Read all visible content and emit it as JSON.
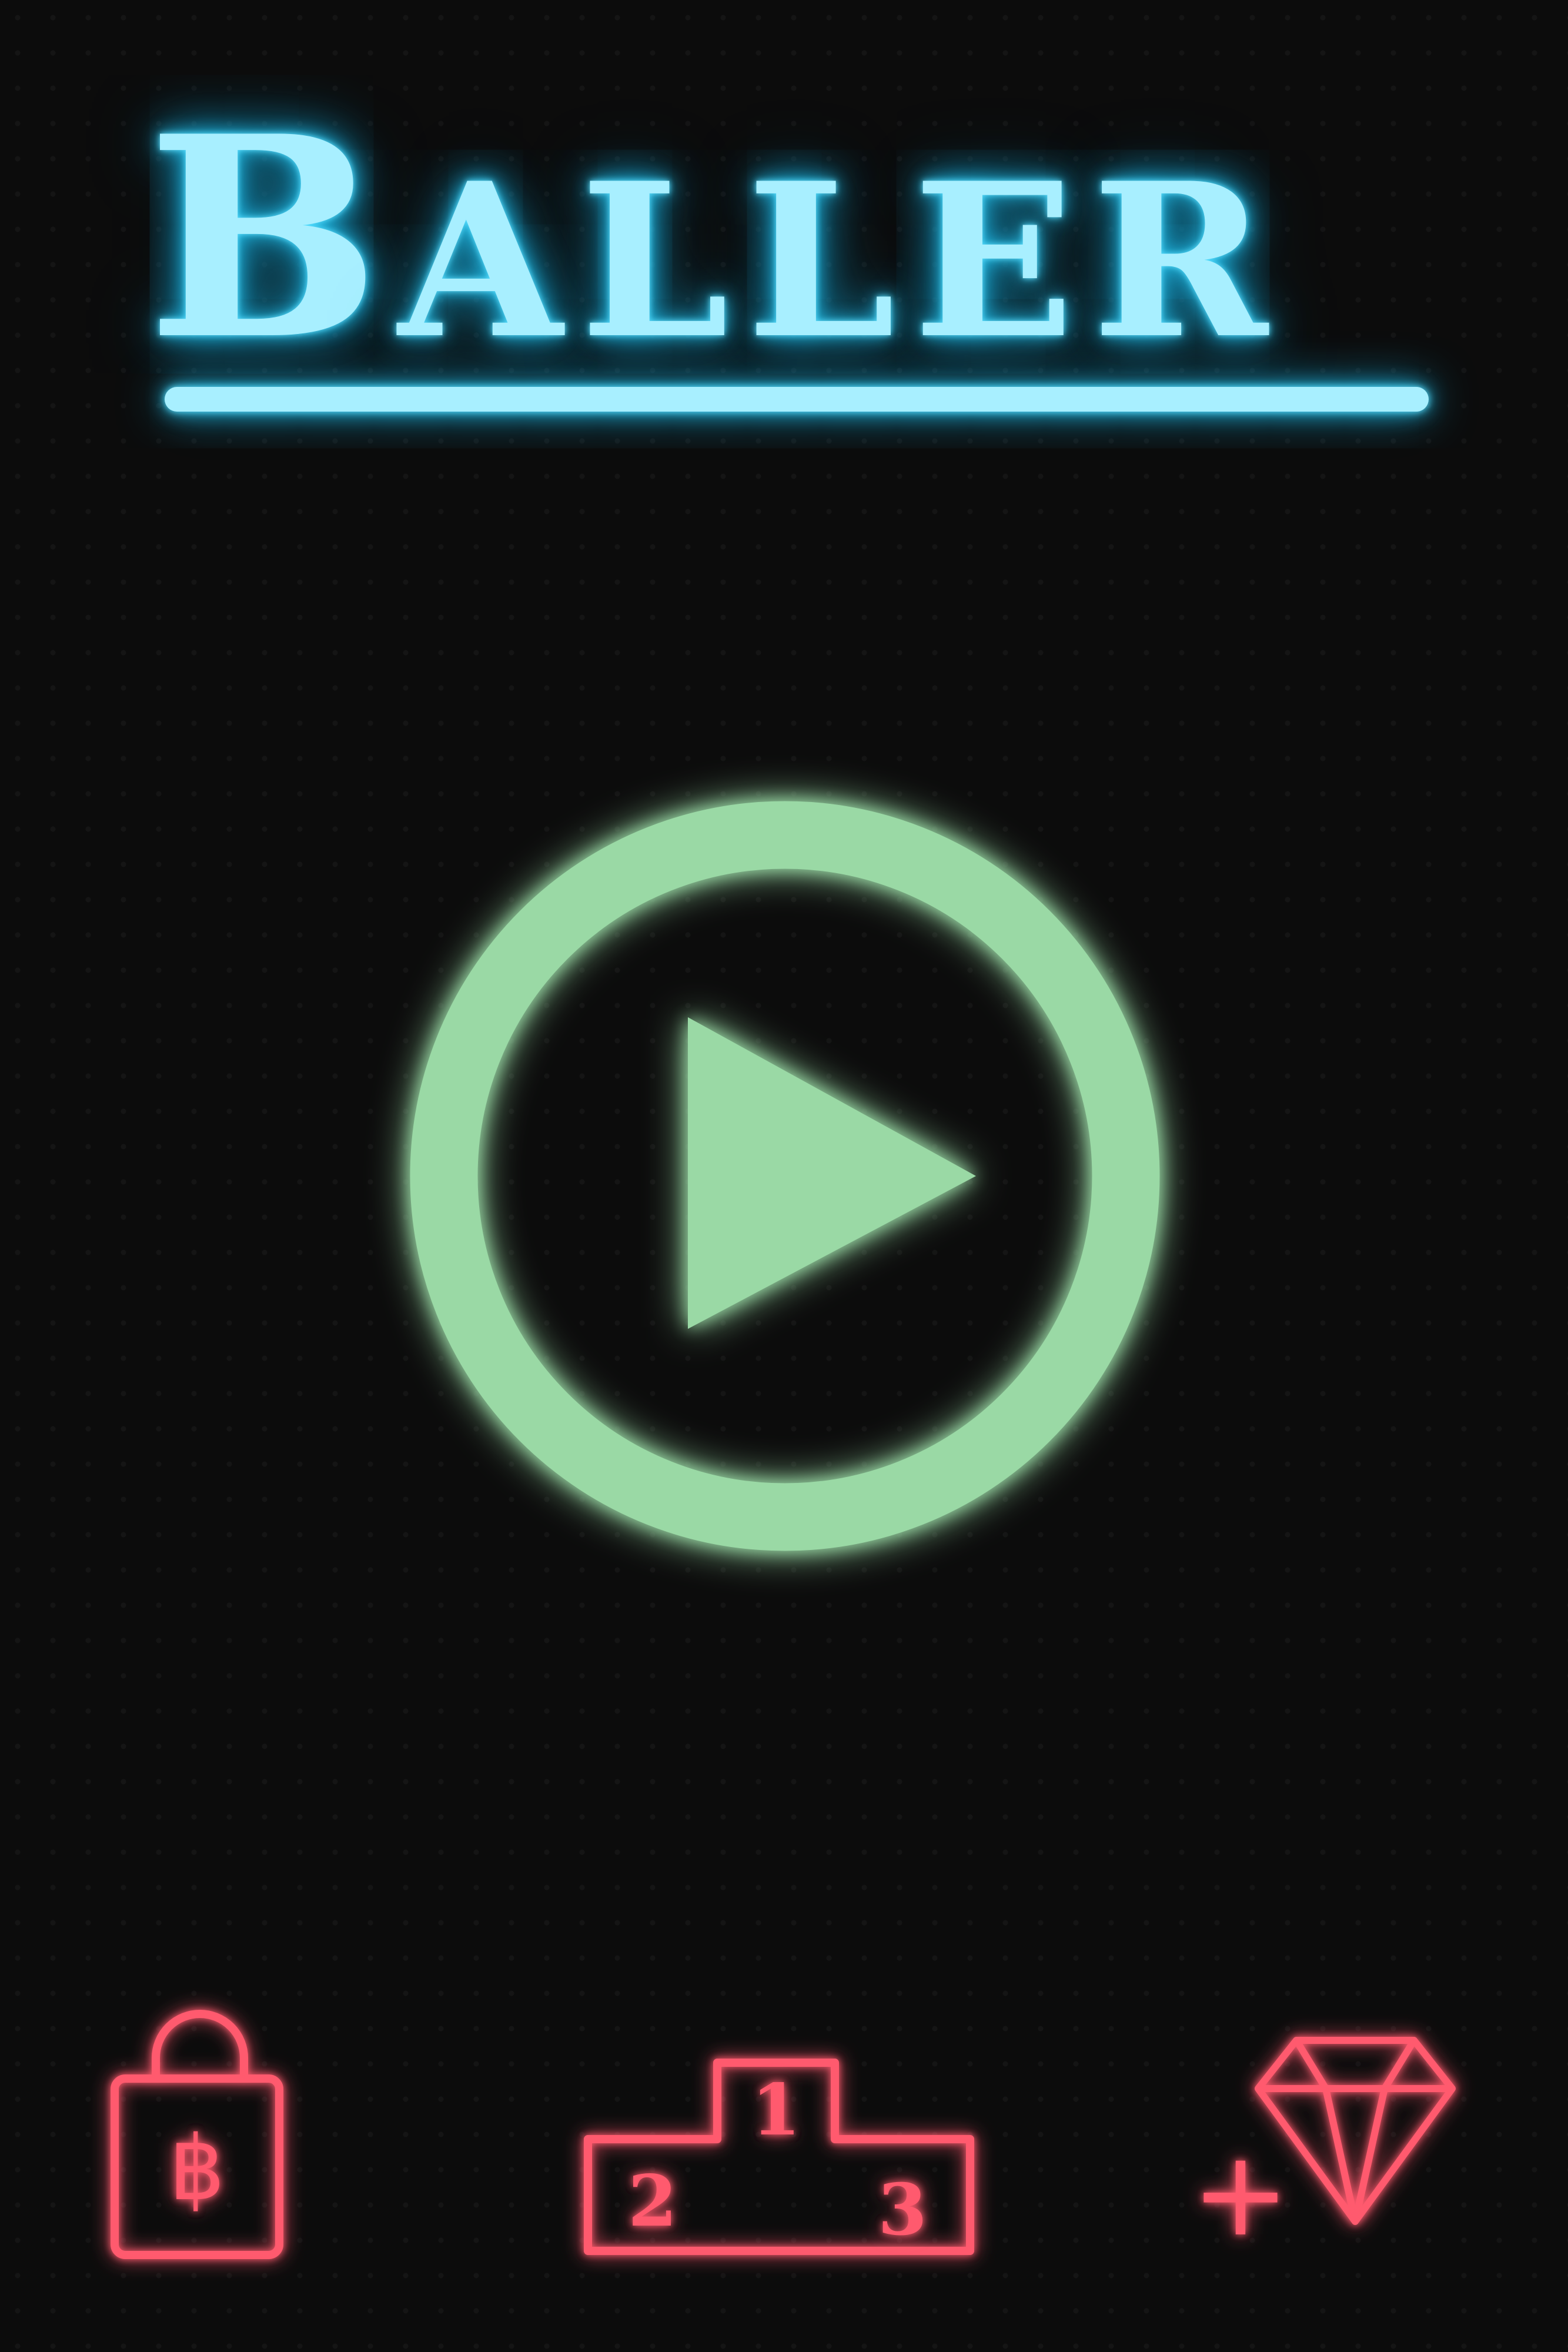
{
  "title": {
    "first_letter": "B",
    "rest": "ALLER",
    "color": "#a8efff",
    "glow_color": "#27c3ee"
  },
  "play_button": {
    "icon": "play-circle-icon",
    "color": "#9ad9a5",
    "glow_color": "#22c45a"
  },
  "bottom_bar": {
    "color": "#ff5a6e",
    "glow_color": "#ff1e3c",
    "items": [
      {
        "name": "shop",
        "icon": "shopping-bag-baht-icon",
        "symbol": "฿"
      },
      {
        "name": "leaderboard",
        "icon": "podium-icon",
        "places": [
          "1",
          "2",
          "3"
        ]
      },
      {
        "name": "get-gems",
        "icon": "plus-diamond-icon",
        "symbol": "+"
      }
    ]
  }
}
